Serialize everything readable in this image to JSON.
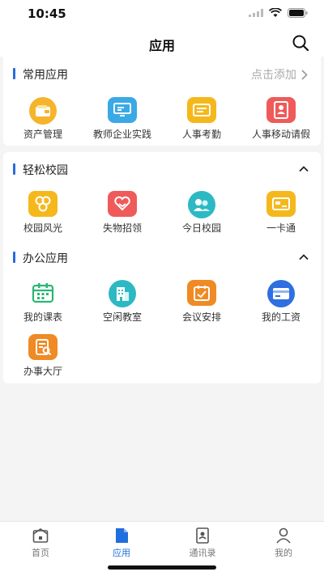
{
  "status": {
    "time": "10:45"
  },
  "header": {
    "title": "应用"
  },
  "common": {
    "title": "常用应用",
    "action": "点击添加",
    "items": [
      {
        "label": "资产管理",
        "icon": "wallet-icon",
        "color": "#f5b429"
      },
      {
        "label": "教师企业实践",
        "icon": "monitor-icon",
        "color": "#3aa9e6"
      },
      {
        "label": "人事考勤",
        "icon": "id-card-icon",
        "color": "#f5b81c"
      },
      {
        "label": "人事移动请假",
        "icon": "leave-form-icon",
        "color": "#ef5a5a"
      }
    ]
  },
  "campus": {
    "title": "轻松校园",
    "items": [
      {
        "label": "校园风光",
        "icon": "hexagons-icon",
        "color": "#f5b81c"
      },
      {
        "label": "失物招领",
        "icon": "heart-hand-icon",
        "color": "#ef5a5a"
      },
      {
        "label": "今日校园",
        "icon": "chat-people-icon",
        "color": "#2cb9c4"
      },
      {
        "label": "一卡通",
        "icon": "card-icon",
        "color": "#f5b81c"
      }
    ]
  },
  "office": {
    "title": "办公应用",
    "items": [
      {
        "label": "我的课表",
        "icon": "calendar-icon",
        "color": "#2bb673"
      },
      {
        "label": "空闲教室",
        "icon": "building-icon",
        "color": "#2cb9c4"
      },
      {
        "label": "会议安排",
        "icon": "meeting-icon",
        "color": "#f08a24"
      },
      {
        "label": "我的工资",
        "icon": "salary-card-icon",
        "color": "#2f6fe0"
      },
      {
        "label": "办事大厅",
        "icon": "service-hall-icon",
        "color": "#f08a24"
      }
    ]
  },
  "tabbar": {
    "items": [
      {
        "label": "首页",
        "icon": "home-icon"
      },
      {
        "label": "应用",
        "icon": "apps-icon",
        "active": true
      },
      {
        "label": "通讯录",
        "icon": "contacts-icon"
      },
      {
        "label": "我的",
        "icon": "profile-icon"
      }
    ],
    "active_color": "#1f6fde"
  }
}
